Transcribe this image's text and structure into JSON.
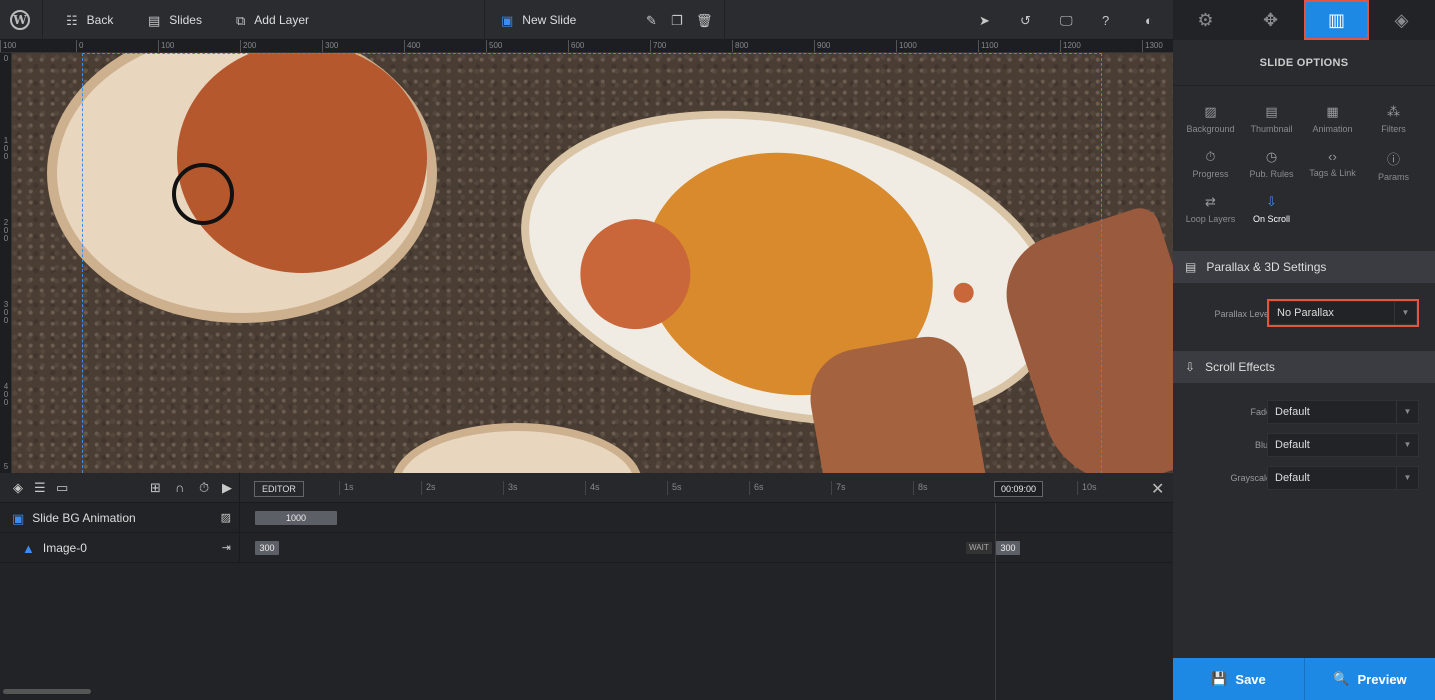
{
  "topbar": {
    "back_label": "Back",
    "slides_label": "Slides",
    "add_layer_label": "Add Layer",
    "slide_name": "New Slide"
  },
  "ruler": {
    "h_ticks": [
      "100",
      "0",
      "100",
      "200",
      "300",
      "400",
      "500",
      "600",
      "700",
      "800",
      "900",
      "1000",
      "1100",
      "1200",
      "1300"
    ],
    "v_ticks": [
      "0",
      "1 0 0",
      "2 0 0",
      "3 0 0",
      "4 0 0",
      "5"
    ]
  },
  "timeline": {
    "editor_label": "EDITOR",
    "seconds": [
      "1s",
      "2s",
      "3s",
      "4s",
      "5s",
      "6s",
      "7s",
      "8s",
      "9s",
      "10s"
    ],
    "time_display": "00:09:00",
    "rows": [
      {
        "label": "Slide BG Animation",
        "bar_value": "1000"
      },
      {
        "label": "Image-0",
        "start_value": "300",
        "wait_label": "WAIT",
        "end_value": "300"
      }
    ]
  },
  "panel": {
    "title": "SLIDE OPTIONS",
    "options": [
      {
        "label": "Background",
        "icon": "image-icon"
      },
      {
        "label": "Thumbnail",
        "icon": "thumbnail-icon"
      },
      {
        "label": "Animation",
        "icon": "film-icon"
      },
      {
        "label": "Filters",
        "icon": "filters-icon"
      },
      {
        "label": "Progress",
        "icon": "stopwatch-icon"
      },
      {
        "label": "Pub. Rules",
        "icon": "clock-icon"
      },
      {
        "label": "Tags & Link",
        "icon": "code-icon"
      },
      {
        "label": "Params",
        "icon": "info-icon"
      },
      {
        "label": "Loop Layers",
        "icon": "loop-icon"
      },
      {
        "label": "On Scroll",
        "icon": "scroll-icon"
      }
    ],
    "parallax_section": "Parallax & 3D Settings",
    "parallax_level_label": "Parallax Level",
    "parallax_level_value": "No Parallax",
    "scroll_section": "Scroll Effects",
    "fade_label": "Fade",
    "fade_value": "Default",
    "blur_label": "Blur",
    "blur_value": "Default",
    "grayscale_label": "Grayscale",
    "grayscale_value": "Default",
    "save_label": "Save",
    "preview_label": "Preview"
  },
  "colors": {
    "accent": "#1e88e5",
    "highlight": "#e2553f"
  }
}
